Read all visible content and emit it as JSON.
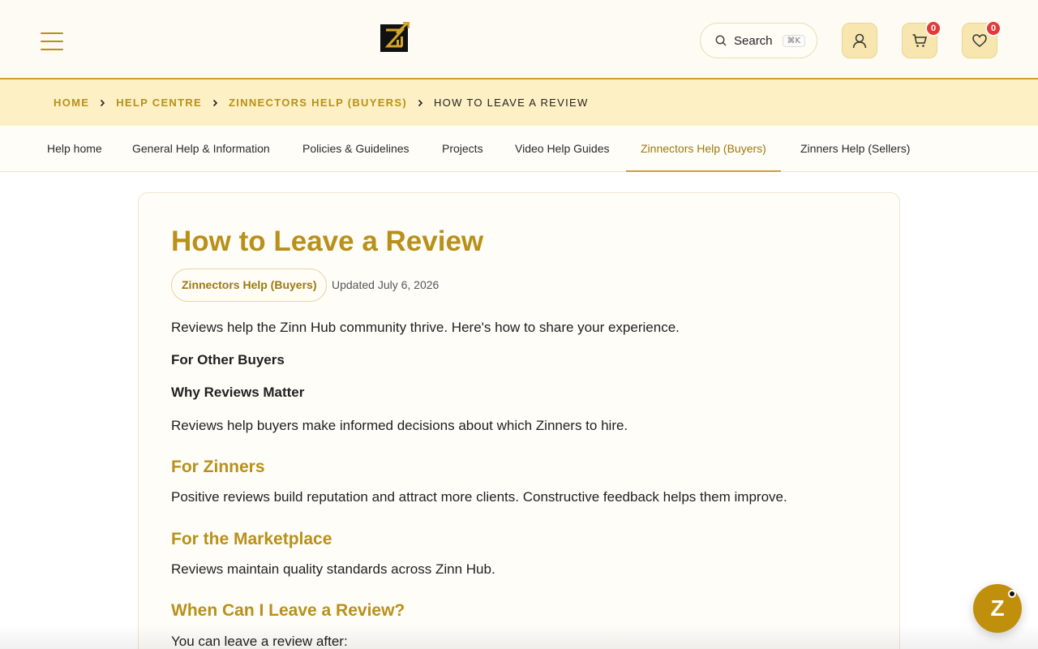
{
  "header": {
    "search_label": "Search",
    "search_shortcut": "⌘K",
    "cart_count": "0",
    "wishlist_count": "0",
    "accent_color": "#b8901a"
  },
  "breadcrumb": [
    {
      "label": "HOME"
    },
    {
      "label": "HELP CENTRE"
    },
    {
      "label": "ZINNECTORS HELP (BUYERS)"
    },
    {
      "label": "HOW TO LEAVE A REVIEW"
    }
  ],
  "nav": {
    "tabs": [
      {
        "label": "Help home"
      },
      {
        "label": "General Help & Information"
      },
      {
        "label": "Policies & Guidelines"
      },
      {
        "label": "Projects"
      },
      {
        "label": "Video Help Guides"
      },
      {
        "label": "Zinnectors Help (Buyers)"
      },
      {
        "label": "Zinners Help (Sellers)"
      }
    ],
    "active_tab": "Zinnectors Help (Buyers)"
  },
  "article": {
    "title": "How to Leave a Review",
    "category": "Zinnectors Help (Buyers)",
    "updated": "Updated July 6, 2026",
    "intro": "Reviews help the Zinn Hub community thrive. Here's how to share your experience.",
    "bold1": "For Other Buyers",
    "bold2": "Why Reviews Matter",
    "para1": "Reviews help buyers make informed decisions about which Zinners to hire.",
    "h_zinners": "For Zinners",
    "para2": "Positive reviews build reputation and attract more clients. Constructive feedback helps them improve.",
    "h_marketplace": "For the Marketplace",
    "para3": "Reviews maintain quality standards across Zinn Hub.",
    "h_when": "When Can I Leave a Review?",
    "para4": "You can leave a review after:"
  },
  "chat": {
    "label": "Z"
  }
}
